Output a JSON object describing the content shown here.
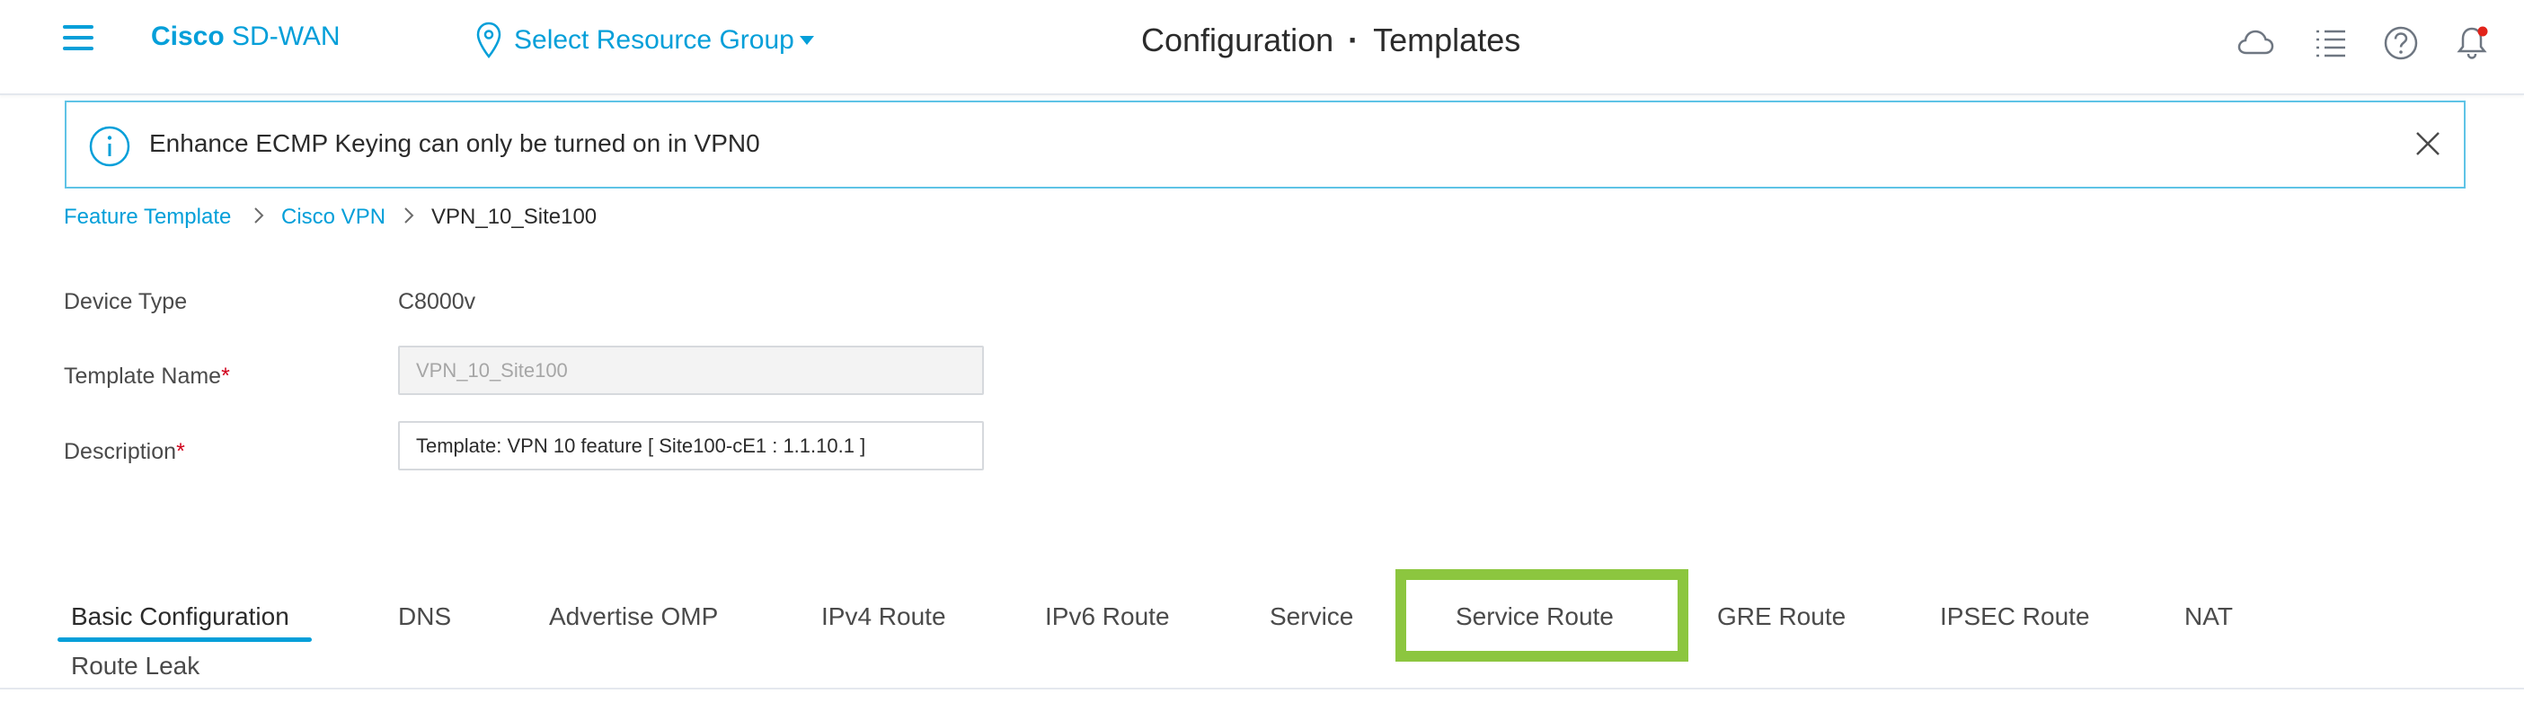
{
  "header": {
    "brand_bold": "Cisco",
    "brand_rest": "SD-WAN",
    "resource_group": "Select Resource Group",
    "title_left": "Configuration",
    "title_separator": "·",
    "title_right": "Templates",
    "icons": [
      "menu-icon",
      "location-pin-icon",
      "cloud-icon",
      "task-list-icon",
      "help-icon",
      "notification-bell-icon"
    ],
    "accent_color": "#049fd9",
    "notification_dot_color": "#e2231a"
  },
  "banner": {
    "message": "Enhance ECMP Keying can only be turned on in VPN0",
    "border_color": "#5fc3e6"
  },
  "breadcrumb": {
    "items": [
      "Feature Template",
      "Cisco VPN",
      "VPN_10_Site100"
    ]
  },
  "form": {
    "device_type_label": "Device Type",
    "device_type_value": "C8000v",
    "template_name_label": "Template Name",
    "template_name_value": "VPN_10_Site100",
    "description_label": "Description",
    "description_value": "Template: VPN 10 feature [ Site100-cE1 : 1.1.10.1 ]",
    "required_marker": "*"
  },
  "tabs": {
    "items": [
      "Basic Configuration",
      "DNS",
      "Advertise OMP",
      "IPv4 Route",
      "IPv6 Route",
      "Service",
      "Service Route",
      "GRE Route",
      "IPSEC Route",
      "NAT",
      "Route Leak"
    ],
    "active": "Basic Configuration",
    "highlighted": "Service Route",
    "highlight_color": "#8cc63f"
  }
}
